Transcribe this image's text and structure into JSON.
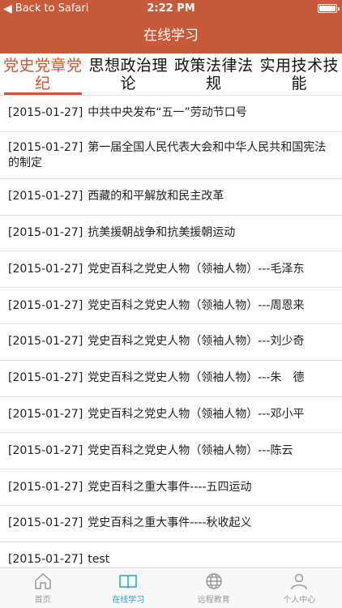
{
  "status_bar": {
    "back_label": "Back to Safari",
    "time": "2:22 PM"
  },
  "nav": {
    "title": "在线学习"
  },
  "category_tabs": [
    {
      "label": "党史党章党纪",
      "active": true
    },
    {
      "label": "思想政治理论",
      "active": false
    },
    {
      "label": "政策法律法规",
      "active": false
    },
    {
      "label": "实用技术技能",
      "active": false
    }
  ],
  "articles": [
    {
      "date": "[2015-01-27]",
      "title": "中共中央发布“五一”劳动节口号"
    },
    {
      "date": "[2015-01-27]",
      "title": "第一届全国人民代表大会和中华人民共和国宪法的制定"
    },
    {
      "date": "[2015-01-27]",
      "title": "西藏的和平解放和民主改革"
    },
    {
      "date": "[2015-01-27]",
      "title": "抗美援朝战争和抗美援朝运动"
    },
    {
      "date": "[2015-01-27]",
      "title": "党史百科之党史人物（领袖人物）---毛泽东"
    },
    {
      "date": "[2015-01-27]",
      "title": "党史百科之党史人物（领袖人物）---周恩来"
    },
    {
      "date": "[2015-01-27]",
      "title": "党史百科之党史人物（领袖人物）---刘少奇"
    },
    {
      "date": "[2015-01-27]",
      "title": "党史百科之党史人物（领袖人物）---朱　德"
    },
    {
      "date": "[2015-01-27]",
      "title": "党史百科之党史人物（领袖人物）---邓小平"
    },
    {
      "date": "[2015-01-27]",
      "title": "党史百科之党史人物（领袖人物）---陈云"
    },
    {
      "date": "[2015-01-27]",
      "title": "党史百科之重大事件----五四运动"
    },
    {
      "date": "[2015-01-27]",
      "title": "党史百科之重大事件----秋收起义"
    },
    {
      "date": "[2015-01-27]",
      "title": "test"
    }
  ],
  "tab_bar": [
    {
      "label": "首页",
      "icon": "home-icon",
      "active": false
    },
    {
      "label": "在线学习",
      "icon": "book-icon",
      "active": true
    },
    {
      "label": "远程教育",
      "icon": "globe-icon",
      "active": false
    },
    {
      "label": "个人中心",
      "icon": "person-icon",
      "active": false
    }
  ],
  "colors": {
    "header": "#c85a3a",
    "tab_active": "#d2552e",
    "tabbar_active": "#2aa3c4"
  }
}
